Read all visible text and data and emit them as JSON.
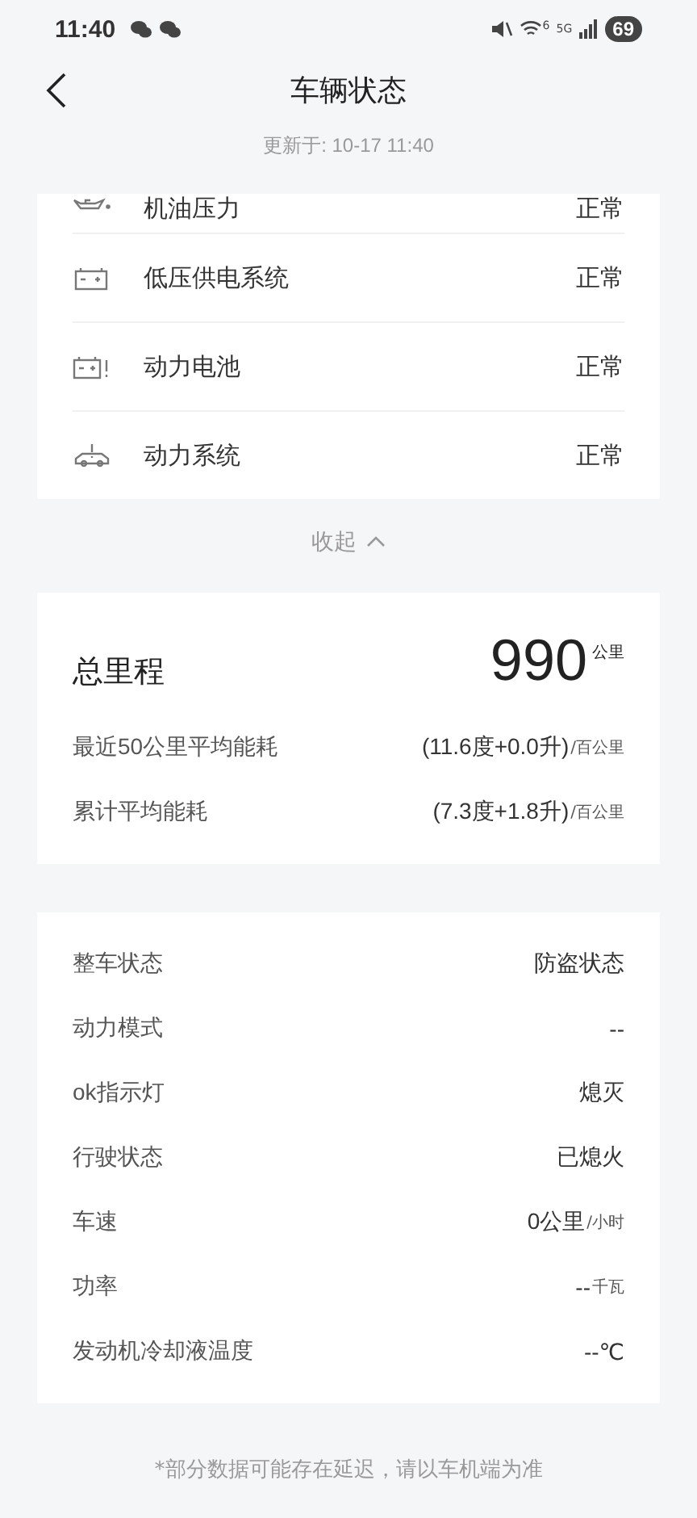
{
  "status_bar": {
    "time": "11:40",
    "wifi_label": "6",
    "network": "5G",
    "battery": "69"
  },
  "header": {
    "title": "车辆状态",
    "updated": "更新于: 10-17 11:40"
  },
  "checks": [
    {
      "kind": "oil",
      "label": "机油压力",
      "value": "正常"
    },
    {
      "kind": "battery",
      "label": "低压供电系统",
      "value": "正常"
    },
    {
      "kind": "battery-alert",
      "label": "动力电池",
      "value": "正常"
    },
    {
      "kind": "car-alert",
      "label": "动力系统",
      "value": "正常"
    }
  ],
  "collapse": {
    "label": "收起",
    "expanded": true
  },
  "mileage": {
    "label": "总里程",
    "value": "990",
    "unit": "公里",
    "rows": [
      {
        "label": "最近50公里平均能耗",
        "value": "(11.6度+0.0升)",
        "unit": "/百公里"
      },
      {
        "label": "累计平均能耗",
        "value": "(7.3度+1.8升)",
        "unit": "/百公里"
      }
    ]
  },
  "details": [
    {
      "label": "整车状态",
      "value": "防盗状态"
    },
    {
      "label": "动力模式",
      "value": "--"
    },
    {
      "label": "ok指示灯",
      "value": "熄灭"
    },
    {
      "label": "行驶状态",
      "value": "已熄火"
    },
    {
      "label": "车速",
      "value": "0公里",
      "unit": "/小时"
    },
    {
      "label": "功率",
      "value": "--",
      "unit": "千瓦"
    },
    {
      "label": "发动机冷却液温度",
      "value": "--℃"
    }
  ],
  "footnote": "*部分数据可能存在延迟，请以车机端为准"
}
